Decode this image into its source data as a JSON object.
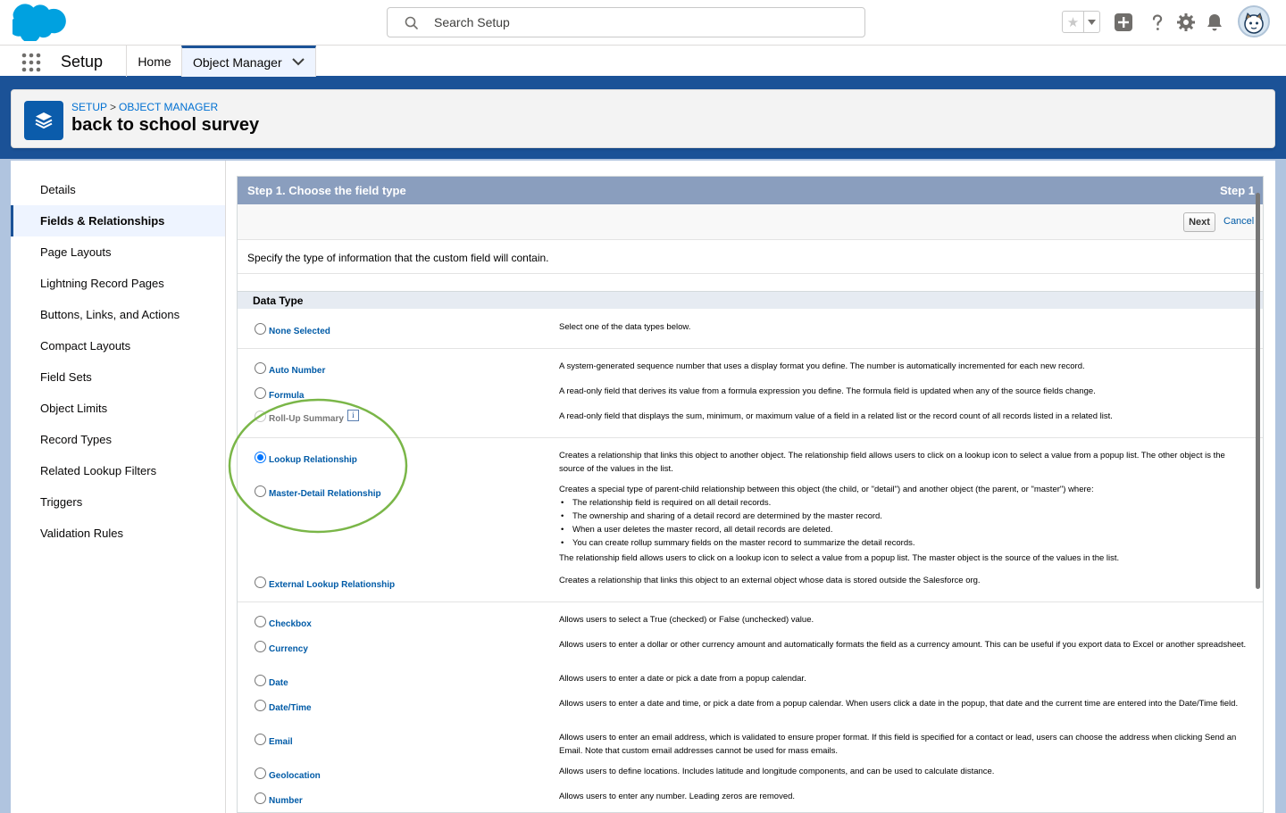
{
  "header": {
    "search_placeholder": "Search Setup"
  },
  "context_bar": {
    "app_name": "Setup",
    "tabs": [
      {
        "label": "Home"
      },
      {
        "label": "Object Manager"
      }
    ]
  },
  "page_header": {
    "breadcrumb": [
      "SETUP",
      "OBJECT MANAGER"
    ],
    "title": "back to school survey"
  },
  "sidebar": {
    "items": [
      {
        "label": "Details"
      },
      {
        "label": "Fields & Relationships",
        "active": true
      },
      {
        "label": "Page Layouts"
      },
      {
        "label": "Lightning Record Pages"
      },
      {
        "label": "Buttons, Links, and Actions"
      },
      {
        "label": "Compact Layouts"
      },
      {
        "label": "Field Sets"
      },
      {
        "label": "Object Limits"
      },
      {
        "label": "Record Types"
      },
      {
        "label": "Related Lookup Filters"
      },
      {
        "label": "Triggers"
      },
      {
        "label": "Validation Rules"
      }
    ]
  },
  "wizard": {
    "step_title": "Step 1. Choose the field type",
    "step_number": "Step 1",
    "next_label": "Next",
    "cancel_label": "Cancel",
    "intro": "Specify the type of information that the custom field will contain.",
    "section_title": "Data Type",
    "options": [
      {
        "label": "None Selected",
        "desc": "Select one of the data types below."
      },
      {
        "label": "Auto Number",
        "desc": "A system-generated sequence number that uses a display format you define. The number is automatically incremented for each new record."
      },
      {
        "label": "Formula",
        "desc": "A read-only field that derives its value from a formula expression you define. The formula field is updated when any of the source fields change."
      },
      {
        "label": "Roll-Up Summary",
        "disabled": true,
        "info_icon": "i",
        "desc": "A read-only field that displays the sum, minimum, or maximum value of a field in a related list or the record count of all records listed in a related list."
      },
      {
        "label": "Lookup Relationship",
        "selected": true,
        "desc": "Creates a relationship that links this object to another object. The relationship field allows users to click on a lookup icon to select a value from a popup list. The other object is the source of the values in the list."
      },
      {
        "label": "Master-Detail Relationship",
        "desc": "Creates a special type of parent-child relationship between this object (the child, or \"detail\") and another object (the parent, or \"master\") where:",
        "bullets": [
          "The relationship field is required on all detail records.",
          "The ownership and sharing of a detail record are determined by the master record.",
          "When a user deletes the master record, all detail records are deleted.",
          "You can create rollup summary fields on the master record to summarize the detail records."
        ],
        "desc_tail": "The relationship field allows users to click on a lookup icon to select a value from a popup list. The master object is the source of the values in the list."
      },
      {
        "label": "External Lookup Relationship",
        "desc": "Creates a relationship that links this object to an external object whose data is stored outside the Salesforce org."
      },
      {
        "label": "Checkbox",
        "desc": "Allows users to select a True (checked) or False (unchecked) value."
      },
      {
        "label": "Currency",
        "desc": "Allows users to enter a dollar or other currency amount and automatically formats the field as a currency amount. This can be useful if you export data to Excel or another spreadsheet."
      },
      {
        "label": "Date",
        "desc": "Allows users to enter a date or pick a date from a popup calendar."
      },
      {
        "label": "Date/Time",
        "desc": "Allows users to enter a date and time, or pick a date from a popup calendar. When users click a date in the popup, that date and the current time are entered into the Date/Time field."
      },
      {
        "label": "Email",
        "desc": "Allows users to enter an email address, which is validated to ensure proper format. If this field is specified for a contact or lead, users can choose the address when clicking Send an Email. Note that custom email addresses cannot be used for mass emails."
      },
      {
        "label": "Geolocation",
        "desc": "Allows users to define locations. Includes latitude and longitude components, and can be used to calculate distance."
      },
      {
        "label": "Number",
        "desc": "Allows users to enter any number. Leading zeros are removed."
      }
    ]
  },
  "colors": {
    "brand_blue": "#1b5297",
    "link_blue": "#015ba7",
    "step_bar": "#8a9ebe",
    "highlight_green": "#7ab648"
  }
}
